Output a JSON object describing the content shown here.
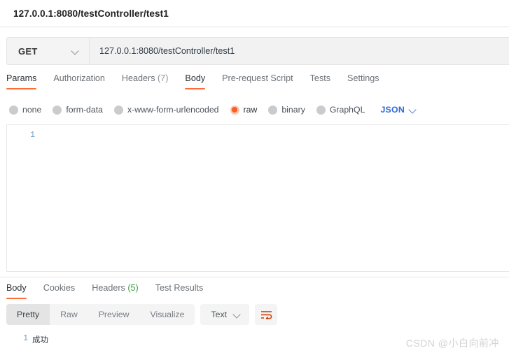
{
  "request": {
    "title": "127.0.0.1:8080/testController/test1",
    "method": "GET",
    "url": "127.0.0.1:8080/testController/test1",
    "tabs": [
      {
        "label": "Params",
        "count": "",
        "active": false
      },
      {
        "label": "Authorization",
        "count": "",
        "active": false
      },
      {
        "label": "Headers",
        "count": "(7)",
        "active": false
      },
      {
        "label": "Body",
        "count": "",
        "active": true
      },
      {
        "label": "Pre-request Script",
        "count": "",
        "active": false
      },
      {
        "label": "Tests",
        "count": "",
        "active": false
      },
      {
        "label": "Settings",
        "count": "",
        "active": false
      }
    ],
    "body_types": [
      {
        "label": "none",
        "selected": false
      },
      {
        "label": "form-data",
        "selected": false
      },
      {
        "label": "x-www-form-urlencoded",
        "selected": false
      },
      {
        "label": "raw",
        "selected": true
      },
      {
        "label": "binary",
        "selected": false
      },
      {
        "label": "GraphQL",
        "selected": false
      }
    ],
    "format": "JSON",
    "editor": {
      "line_number": "1",
      "content": ""
    }
  },
  "response": {
    "tabs": [
      {
        "label": "Body",
        "count": "",
        "active": true
      },
      {
        "label": "Cookies",
        "count": "",
        "active": false
      },
      {
        "label": "Headers",
        "count": "(5)",
        "active": false
      },
      {
        "label": "Test Results",
        "count": "",
        "active": false
      }
    ],
    "view_modes": [
      {
        "label": "Pretty",
        "active": true
      },
      {
        "label": "Raw",
        "active": false
      },
      {
        "label": "Preview",
        "active": false
      },
      {
        "label": "Visualize",
        "active": false
      }
    ],
    "format": "Text",
    "wrap_icon": "wrap-lines-icon",
    "body": {
      "line_number": "1",
      "content": "成功"
    }
  },
  "watermark": "CSDN @小白向前冲",
  "colors": {
    "accent_orange": "#ff6c37",
    "link_blue": "#2f6bd8",
    "count_green": "#3f9d3f"
  }
}
